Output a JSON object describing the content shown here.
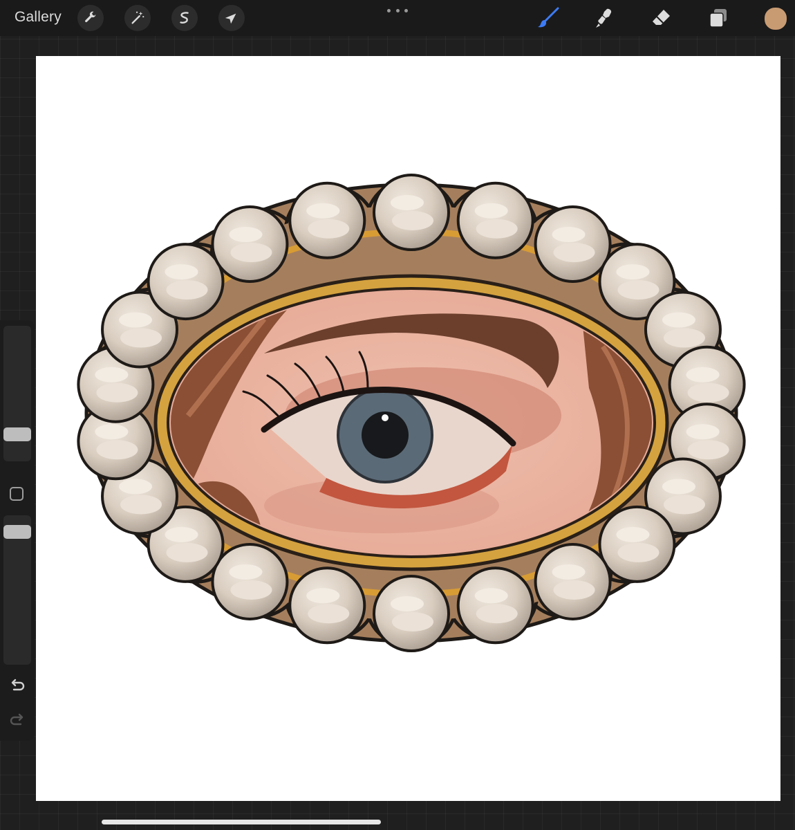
{
  "topbar": {
    "gallery_label": "Gallery",
    "left_tools": [
      "wrench-icon",
      "magic-wand-icon",
      "selection-icon",
      "move-arrow-icon"
    ],
    "right_tools": [
      "brush-icon",
      "smudge-icon",
      "eraser-icon",
      "layers-icon"
    ],
    "active_tool": "brush-icon",
    "current_color": "#c99b72"
  },
  "sidebar": {
    "brush_size_level": 0.25,
    "opacity_level": 0.93,
    "tools": [
      "modify-square-icon",
      "undo-icon",
      "redo-icon"
    ]
  },
  "colors": {
    "accent": "#3d7bf5",
    "gold": "#cf9a3b",
    "pearl": "#e3d8cc",
    "skin": "#e9b4a2",
    "hair": "#8a4f35",
    "iris": "#5b6a77"
  }
}
